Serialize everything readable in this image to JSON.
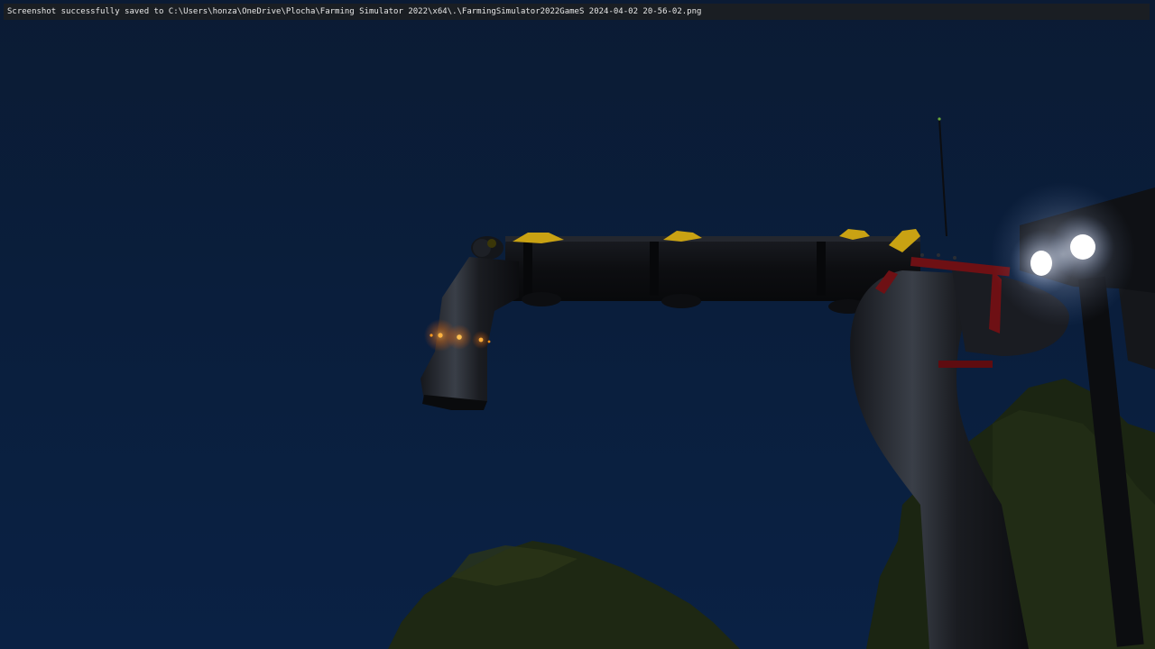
{
  "notification": {
    "text": "Screenshot successfully saved to C:\\Users\\honza\\OneDrive\\Plocha\\Farming Simulator 2022\\x64\\.\\FarmingSimulator2022GameS 2024-04-02 20-56-02.png"
  },
  "scene": {
    "sky_top_color": "#0b1c36",
    "sky_bottom_color": "#0a2040",
    "boom_color": "#0e0f12",
    "accent_yellow": "#d8b21a",
    "frame_red": "#8a1418",
    "amber_light_color": "#ff8a1a",
    "headlight_color": "#ffffff",
    "foliage_color": "#1f2a14"
  }
}
